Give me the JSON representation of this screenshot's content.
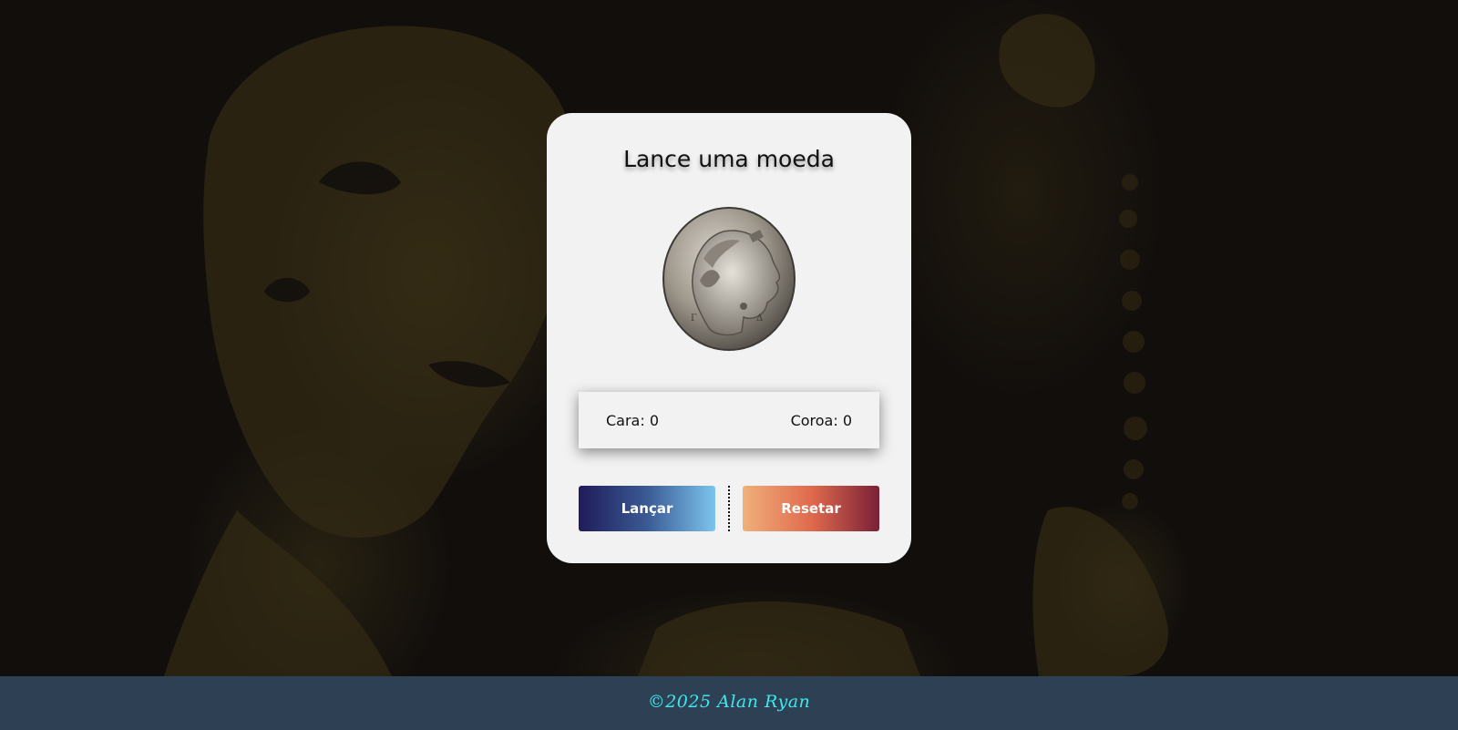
{
  "card": {
    "title": "Lance uma moeda"
  },
  "coin": {
    "icon": "coin-image",
    "alt": "coin"
  },
  "score": {
    "heads": "Cara: 0",
    "tails": "Coroa: 0"
  },
  "buttons": {
    "flip_label": "Lançar",
    "reset_label": "Resetar"
  },
  "footer": {
    "text": "©2025 Alan Ryan"
  },
  "colors": {
    "background": "#120e0c",
    "card": "#f2f2f2",
    "footer": "#2e4053",
    "footer_text": "#3fe8ec",
    "flip_gradient": [
      "#1f1c5a",
      "#7dc4ee"
    ],
    "reset_gradient": [
      "#f0b07a",
      "#7a2036"
    ]
  }
}
